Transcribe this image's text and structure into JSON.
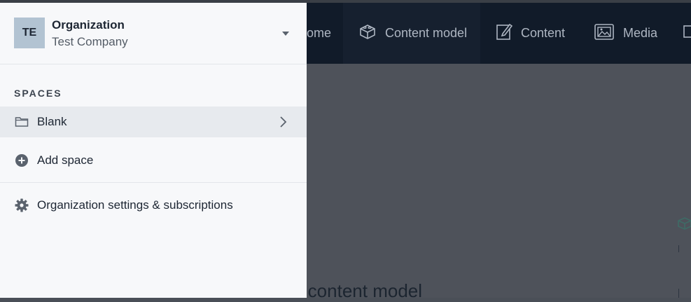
{
  "org_switcher": {
    "avatar_initials": "TE",
    "title": "Organization",
    "company": "Test Company"
  },
  "spaces": {
    "section_title": "SPACES",
    "items": [
      {
        "label": "Blank",
        "icon": "folder-icon"
      }
    ],
    "add_label": "Add space"
  },
  "org_settings_label": "Organization settings & subscriptions",
  "top_nav": {
    "items": [
      {
        "label": "ome",
        "icon": "home-icon"
      },
      {
        "label": "Content model",
        "icon": "cube-icon"
      },
      {
        "label": "Content",
        "icon": "edit-icon"
      },
      {
        "label": "Media",
        "icon": "media-icon"
      }
    ]
  },
  "background": {
    "heading_fragment": "e content model"
  },
  "colors": {
    "nav_bg": "#111b29",
    "panel_bg": "#f7f8fa",
    "selected_row": "#e7eaee",
    "avatar_bg": "#b2c3d2"
  }
}
